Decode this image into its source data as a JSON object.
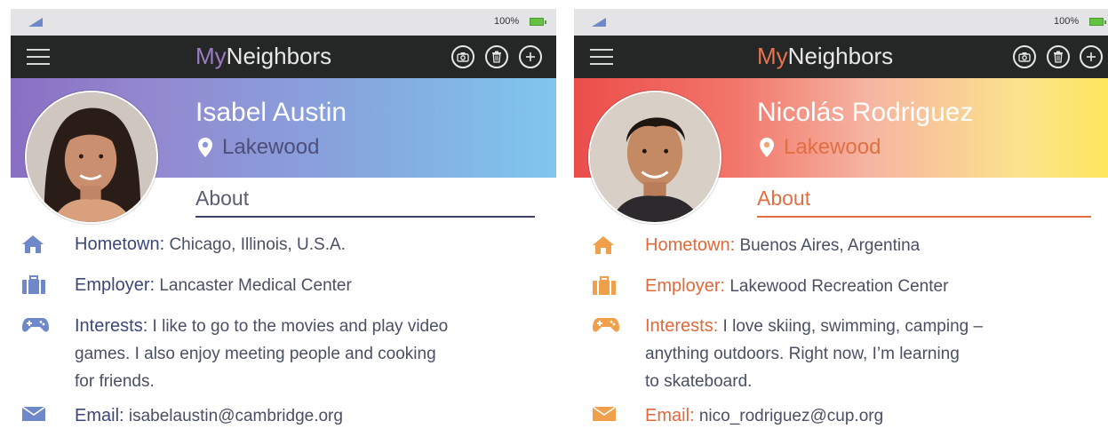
{
  "profiles": [
    {
      "status": {
        "battery": "100%"
      },
      "app_title": {
        "my": "My",
        "rest": "Neighbors"
      },
      "name": "Isabel Austin",
      "location": "Lakewood",
      "about_label": "About",
      "fields": {
        "hometown": {
          "label": "Hometown:",
          "value": "Chicago, Illinois, U.S.A."
        },
        "employer": {
          "label": "Employer:",
          "value": "Lancaster Medical Center"
        },
        "interests": {
          "label": "Interests:",
          "line1": "I like to go to the movies and play video",
          "line2": "games. I also enjoy meeting people and cooking",
          "line3": "for friends."
        },
        "email": {
          "label": "Email:",
          "value": "isabelaustin@cambridge.org"
        }
      },
      "icons": [
        "menu-icon",
        "camera-icon",
        "trash-icon",
        "plus-icon",
        "location-pin-icon",
        "home-icon",
        "briefcase-icon",
        "gamepad-icon",
        "envelope-icon"
      ],
      "colors": {
        "header_gradient_start": "#8a6fc3",
        "header_gradient_end": "#7fc6ee",
        "accent": "#3d4778",
        "icon": "#6e88c9"
      }
    },
    {
      "status": {
        "battery": "100%"
      },
      "app_title": {
        "my": "My",
        "rest": "Neighbors"
      },
      "name": "Nicolás Rodriguez",
      "location": "Lakewood",
      "about_label": "About",
      "fields": {
        "hometown": {
          "label": "Hometown:",
          "value": "Buenos Aires, Argentina"
        },
        "employer": {
          "label": "Employer:",
          "value": "Lakewood Recreation Center"
        },
        "interests": {
          "label": "Interests:",
          "line1": "I love skiing, swimming, camping –",
          "line2": "anything outdoors. Right now, I’m learning",
          "line3": "to skateboard."
        },
        "email": {
          "label": "Email:",
          "value": "nico_rodriguez@cup.org"
        }
      },
      "icons": [
        "menu-icon",
        "camera-icon",
        "trash-icon",
        "plus-icon",
        "location-pin-icon",
        "home-icon",
        "briefcase-icon",
        "gamepad-icon",
        "envelope-icon"
      ],
      "colors": {
        "header_gradient_start": "#ec4d4b",
        "header_gradient_end": "#fde55c",
        "accent": "#e0683a",
        "icon": "#f0a04a"
      }
    }
  ]
}
